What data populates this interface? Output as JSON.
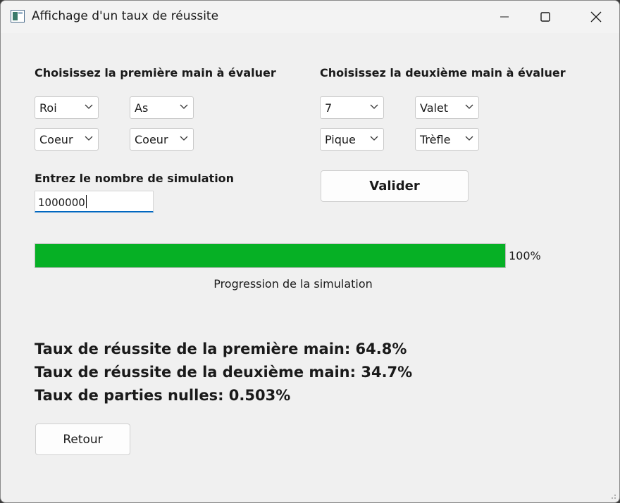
{
  "window": {
    "title": "Affichage d'un taux de réussite"
  },
  "hand1": {
    "heading": "Choisissez la première main à évaluer",
    "card1_rank": "Roi",
    "card2_rank": "As",
    "card1_suit": "Coeur",
    "card2_suit": "Coeur"
  },
  "hand2": {
    "heading": "Choisissez la deuxième main à évaluer",
    "card1_rank": "7",
    "card2_rank": "Valet",
    "card1_suit": "Pique",
    "card2_suit": "Trèfle"
  },
  "simulation": {
    "label": "Entrez le nombre de simulation",
    "value": "1000000",
    "submit_label": "Valider"
  },
  "progress": {
    "percent": 100,
    "percent_text": "100%",
    "caption": "Progression de la simulation",
    "color": "#06b025"
  },
  "results": {
    "hand1_rate": "Taux de réussite de la première main: 64.8%",
    "hand2_rate": "Taux de réussite de la deuxième main: 34.7%",
    "draw_rate": "Taux de parties nulles: 0.503%"
  },
  "back_label": "Retour"
}
